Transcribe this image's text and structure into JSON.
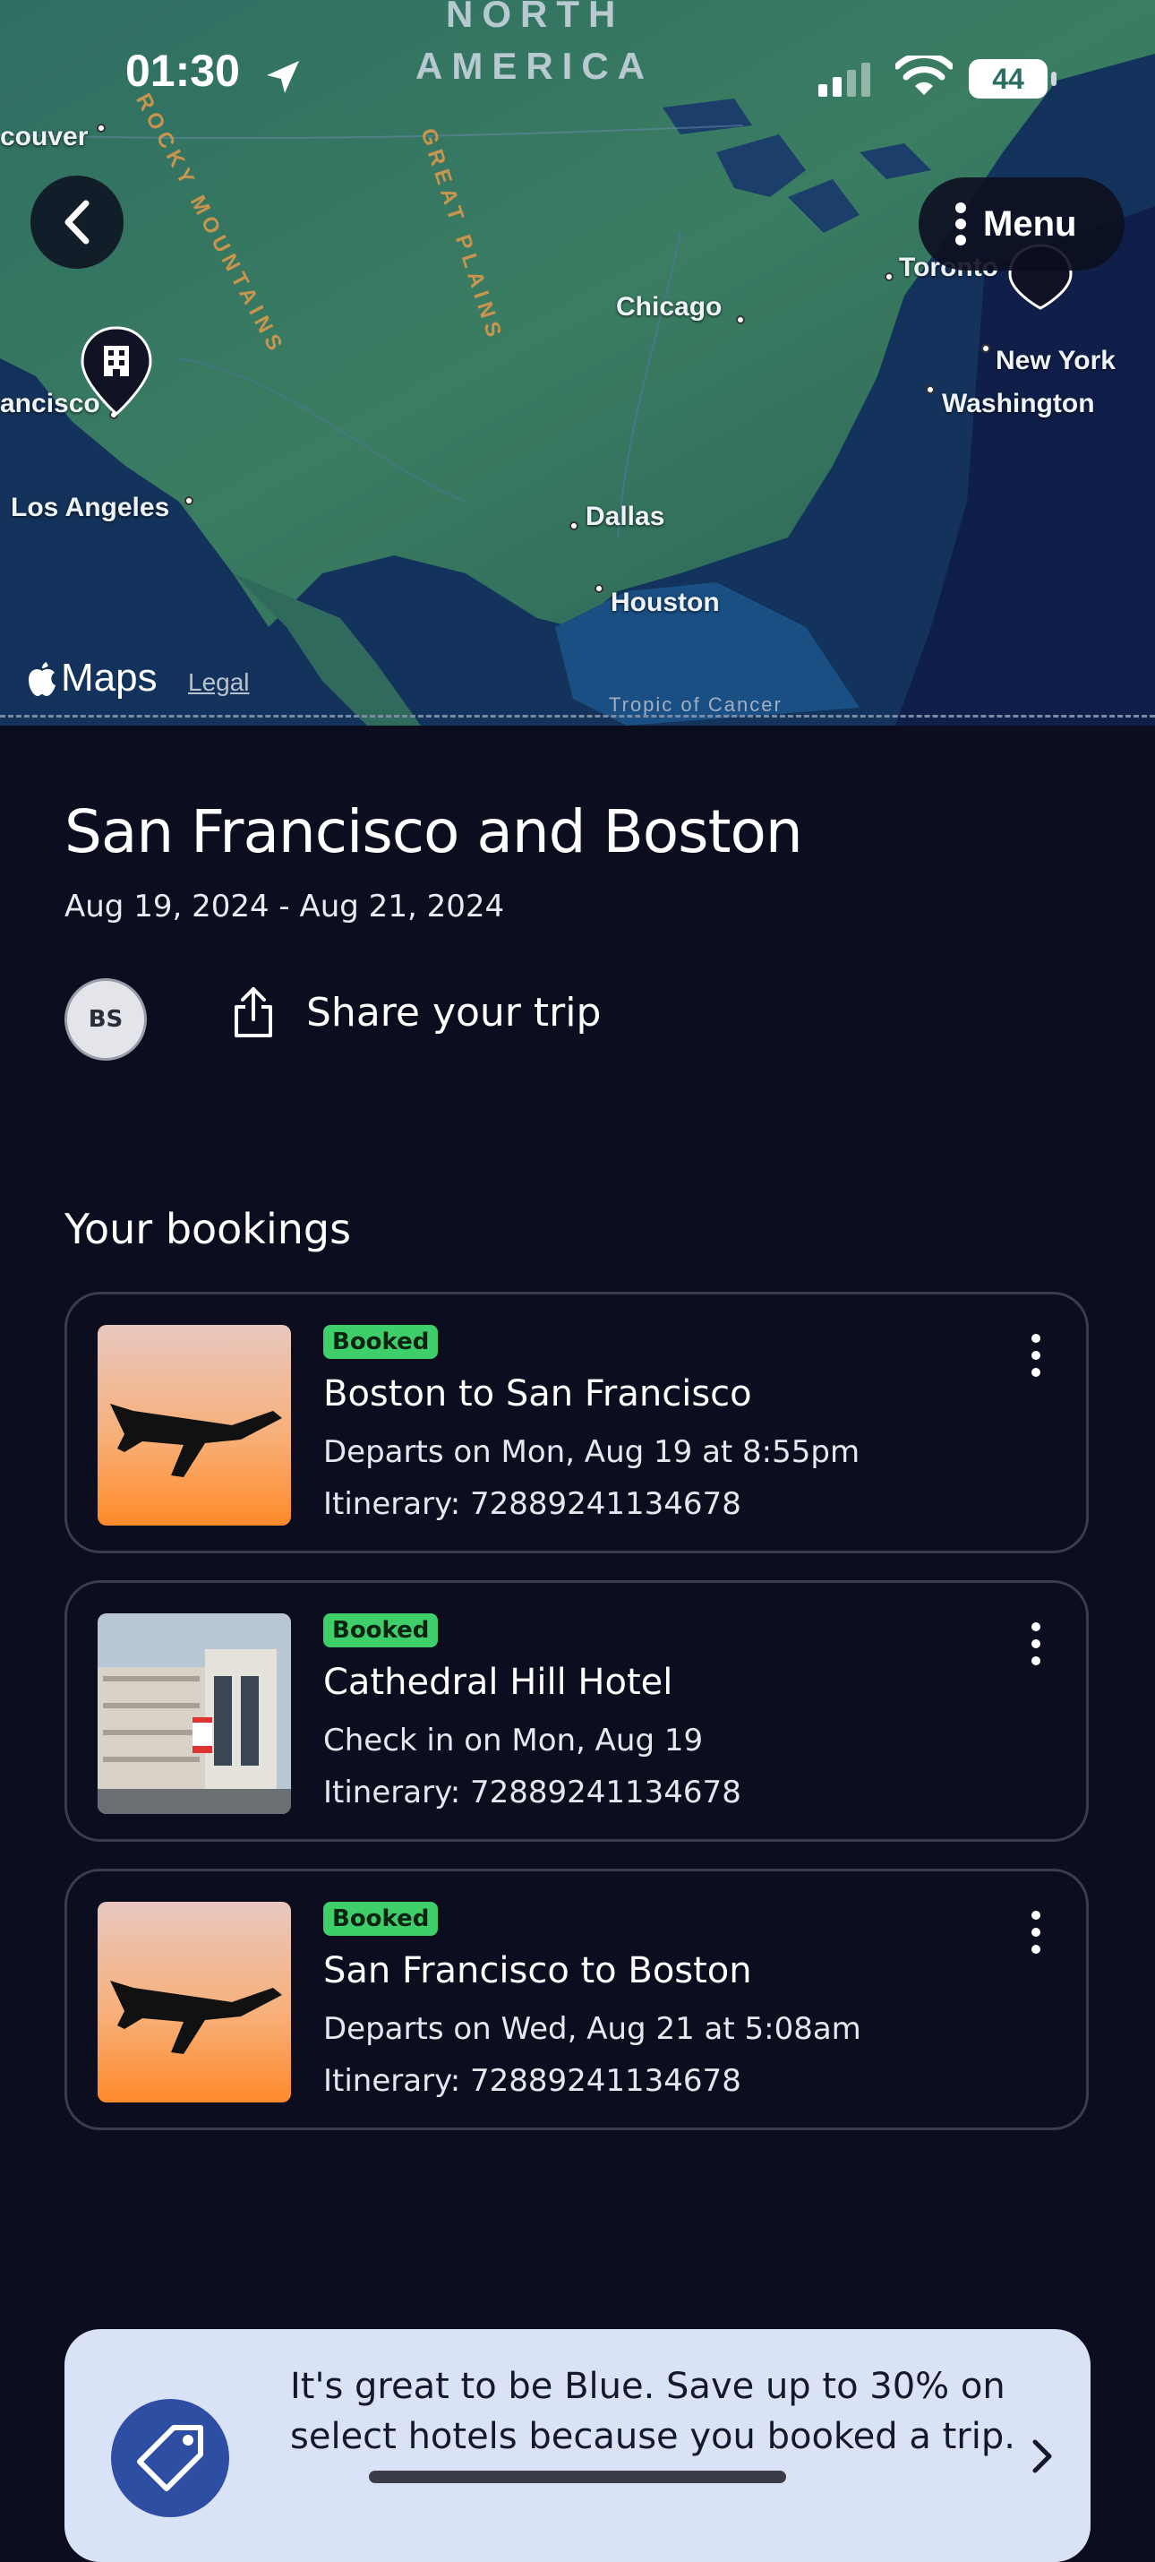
{
  "status_bar": {
    "time": "01:30",
    "battery": "44"
  },
  "map": {
    "region_label_1": "NORTH",
    "region_label_2": "AMERICA",
    "rocky_label": "ROCKY MOUNTAINS",
    "plains_label": "GREAT PLAINS",
    "cities": [
      {
        "name": "couver"
      },
      {
        "name": "ancisco"
      },
      {
        "name": "Los Angeles"
      },
      {
        "name": "Chicago"
      },
      {
        "name": "Toronto"
      },
      {
        "name": "New York"
      },
      {
        "name": "Washington"
      },
      {
        "name": "Dallas"
      },
      {
        "name": "Houston"
      }
    ],
    "maps_brand": "Maps",
    "legal": "Legal",
    "tropic": "Tropic of Cancer"
  },
  "header": {
    "menu_label": "Menu",
    "back_icon": "chevron-left-icon"
  },
  "trip": {
    "title": "San Francisco and Boston",
    "dates": "Aug 19, 2024 - Aug 21, 2024",
    "avatar_initials": "BS",
    "share_label": "Share your trip"
  },
  "bookings": {
    "heading": "Your bookings",
    "items": [
      {
        "badge": "Booked",
        "title": "Boston to San Francisco",
        "line1": "Departs on Mon, Aug 19 at 8:55pm",
        "line2": "Itinerary: 72889241134678",
        "image": "airplane-sunset"
      },
      {
        "badge": "Booked",
        "title": "Cathedral Hill Hotel",
        "line1": "Check in on Mon, Aug 19",
        "line2": "Itinerary: 72889241134678",
        "image": "hotel-building"
      },
      {
        "badge": "Booked",
        "title": "San Francisco to Boston",
        "line1": "Departs on Wed, Aug 21 at 5:08am",
        "line2": "Itinerary: 72889241134678",
        "image": "airplane-sunset"
      }
    ]
  },
  "promo": {
    "text": "It's great to be Blue. Save up to 30% on select hotels because you booked a trip."
  },
  "colors": {
    "background": "#0c0e1f",
    "badge": "#3fcf6a",
    "promo_bg": "#d9e2f7",
    "promo_icon": "#2d4ea3"
  }
}
